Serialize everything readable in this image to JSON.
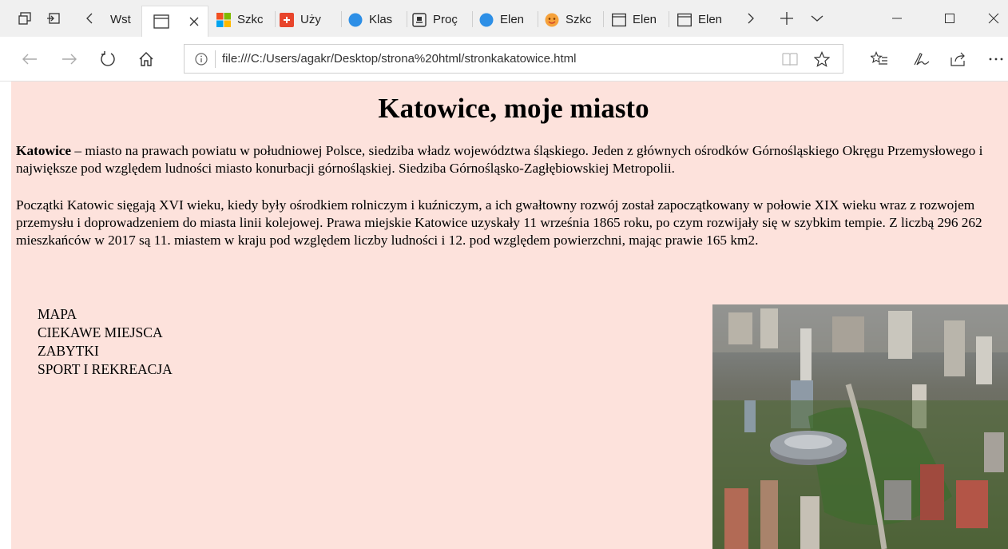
{
  "tabs": [
    {
      "label": "Wst",
      "icon": "page-icon",
      "active": false
    },
    {
      "label": "",
      "icon": "window-icon",
      "active": true
    },
    {
      "label": "Szkc",
      "icon": "windows-logo-icon",
      "active": false
    },
    {
      "label": "Uży",
      "icon": "red-app-icon",
      "active": false
    },
    {
      "label": "Klas",
      "icon": "blue-circle-icon",
      "active": false
    },
    {
      "label": "Proç",
      "icon": "download-icon",
      "active": false
    },
    {
      "label": "Elen",
      "icon": "blue-circle-icon",
      "active": false
    },
    {
      "label": "Szkc",
      "icon": "orange-face-icon",
      "active": false
    },
    {
      "label": "Elen",
      "icon": "window-icon",
      "active": false
    },
    {
      "label": "Elen",
      "icon": "window-icon",
      "active": false
    }
  ],
  "address": {
    "url": "file:///C:/Users/agakr/Desktop/strona%20html/stronkakatowice.html"
  },
  "page": {
    "title": "Katowice, moje miasto",
    "p1_bold": "Katowice",
    "p1_text": " – miasto na prawach powiatu w południowej Polsce, siedziba władz województwa śląskiego. Jeden z głównych ośrodków Górnośląskiego Okręgu Przemysłowego i największe pod względem ludności miasto konurbacji górnośląskiej. Siedziba Górnośląsko-Zagłębiowskiej Metropolii.",
    "p2_text": "Początki Katowic sięgają XVI wieku, kiedy były ośrodkiem rolniczym i kuźniczym, a ich gwałtowny rozwój został zapoczątkowany w połowie XIX wieku wraz z rozwojem przemysłu i doprowadzeniem do miasta linii kolejowej. Prawa miejskie Katowice uzyskały 11 września 1865 roku, po czym rozwijały się w szybkim tempie. Z liczbą 296 262 mieszkańców w 2017 są 11. miastem w kraju pod względem liczby ludności i 12. pod względem powierzchni, mając prawie 165 km2.",
    "menu": [
      "MAPA",
      "CIEKAWE MIEJSCA",
      "ZABYTKI",
      "SPORT I REKREACJA"
    ],
    "bullet": "•"
  }
}
